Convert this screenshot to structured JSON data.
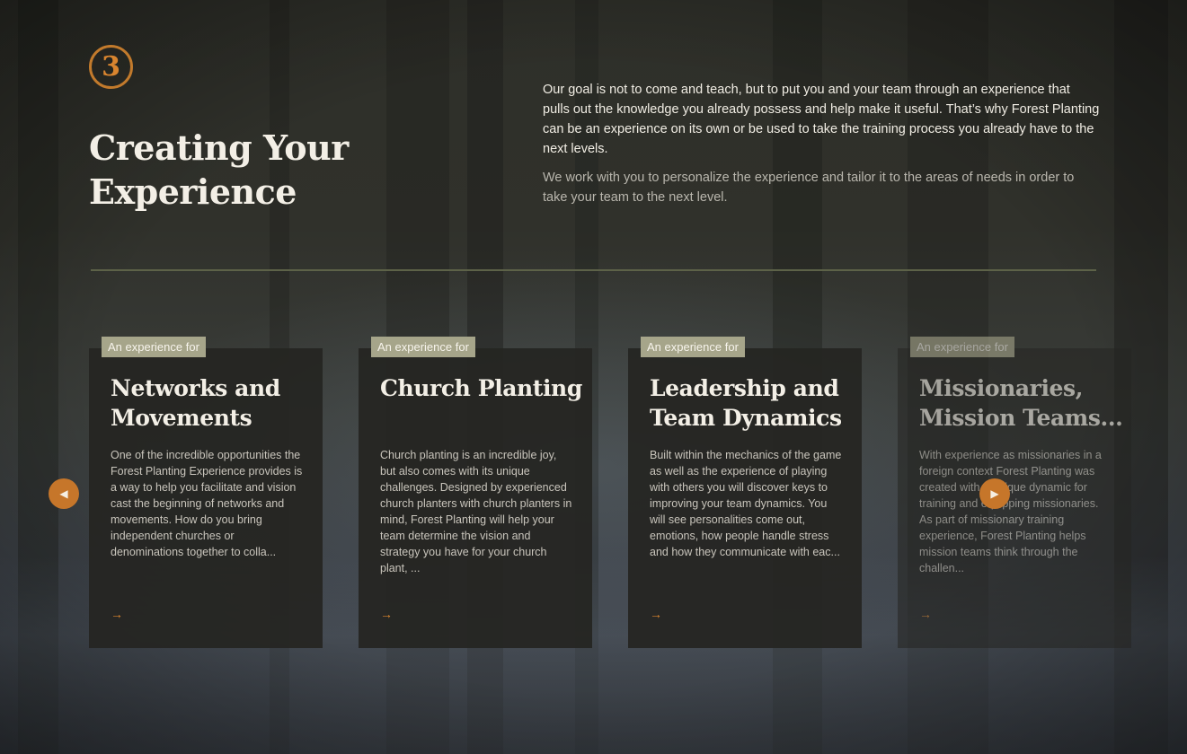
{
  "section": {
    "step_number": "3",
    "title": "Creating Your Experience",
    "intro_lead": "Our goal is not to come and teach, but to put you and your team through an experience that pulls out the knowledge you already possess and help make it useful. That’s why Forest Planting can be an experience on its own or be used to take the training process you already have to the next levels.",
    "intro_sub": "We work with you to personalize the experience and tailor it to the areas of needs in order to take your team to the next level."
  },
  "carousel": {
    "prev_icon": "◀",
    "next_icon": "▶",
    "cards": [
      {
        "tag": "An experience for",
        "title": "Networks and Movements",
        "text": "One of the incredible opportunities the Forest Planting Experience provides is a way to help you facilitate and vision cast the beginning of networks and movements. How do you bring independent churches or denominations together to colla...",
        "arrow": "→"
      },
      {
        "tag": "An experience for",
        "title": "Church Planting",
        "text": "Church planting is an incredible joy, but also comes with its unique challenges. Designed by experienced church planters with church planters in mind, Forest Planting will help your team determine the vision and strategy you have for your church plant, ...",
        "arrow": "→"
      },
      {
        "tag": "An experience for",
        "title": "Leadership and Team Dynamics",
        "text": "Built within the mechanics of the game as well as the experience of playing with others you will discover keys to improving your team dynamics. You will see personalities come out, emotions, how people handle stress and how they communicate with eac...",
        "arrow": "→"
      },
      {
        "tag": "An experience for",
        "title": "Missionaries, Mission Teams...",
        "text": "With experience as missionaries in a foreign context Forest Planting was created with a unique dynamic for training and equipping missionaries. As part of missionary training experience, Forest Planting helps mission teams think through the challen...",
        "arrow": "→"
      }
    ]
  },
  "colors": {
    "accent": "#c6762a",
    "tag_bg": "#a6a58a",
    "card_bg": "#252522",
    "divider": "#5d6248"
  }
}
